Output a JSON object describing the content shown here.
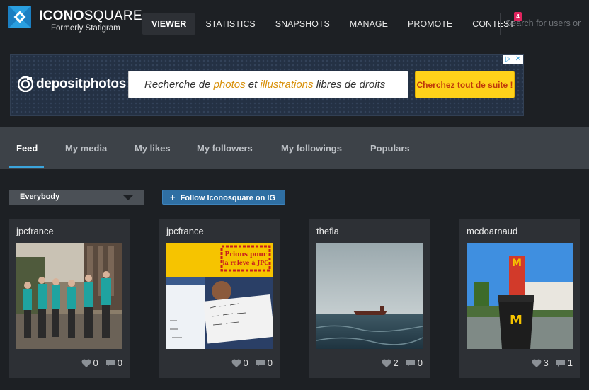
{
  "header": {
    "brand_bold": "ICONO",
    "brand_light": "SQUARE",
    "subtitle": "Formerly Statigram",
    "nav": [
      {
        "label": "VIEWER",
        "active": true
      },
      {
        "label": "STATISTICS"
      },
      {
        "label": "SNAPSHOTS"
      },
      {
        "label": "MANAGE"
      },
      {
        "label": "PROMOTE"
      },
      {
        "label": "CONTEST",
        "badge": "4"
      }
    ],
    "search_placeholder": "Search for users or"
  },
  "ad": {
    "brand": "depositphotos",
    "search_text_1": "Recherche de ",
    "search_hl_1": "photos",
    "search_text_2": " et ",
    "search_hl_2": "illustrations",
    "search_text_3": " libres de droits",
    "button": "Cherchez tout de suite !",
    "corner_1": "▷",
    "corner_2": "✕"
  },
  "tabs": [
    {
      "label": "Feed",
      "active": true
    },
    {
      "label": "My media"
    },
    {
      "label": "My likes"
    },
    {
      "label": "My followers"
    },
    {
      "label": "My followings"
    },
    {
      "label": "Populars"
    }
  ],
  "filters": {
    "audience": "Everybody",
    "follow_button": "Follow Iconosquare on IG"
  },
  "cards": [
    {
      "user": "jpcfrance",
      "likes": "0",
      "comments": "0",
      "image": "group-photo"
    },
    {
      "user": "jpcfrance",
      "likes": "0",
      "comments": "0",
      "image": "sign-photo",
      "sign_text": "Prions pour la relève à JPC"
    },
    {
      "user": "thefla",
      "likes": "2",
      "comments": "0",
      "image": "sea-photo"
    },
    {
      "user": "mcdoarnaud",
      "likes": "3",
      "comments": "1",
      "image": "mcdonalds-photo"
    }
  ]
}
